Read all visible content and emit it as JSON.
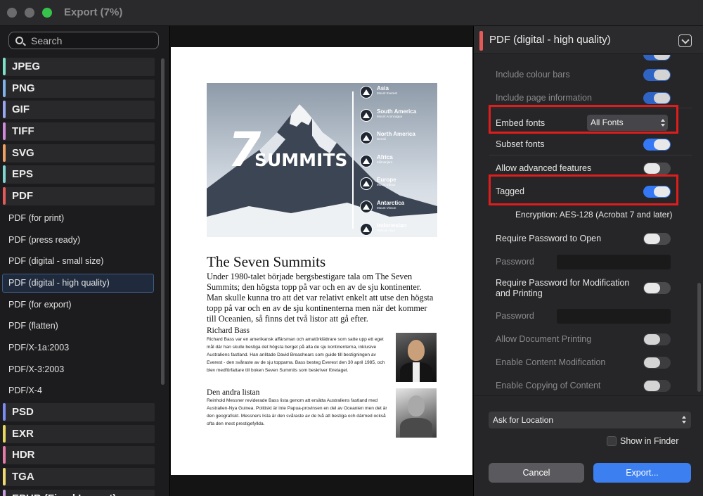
{
  "window": {
    "title": "Export (7%)"
  },
  "sidebar": {
    "search_placeholder": "Search",
    "items": [
      {
        "label": "JPEG",
        "kind": "header",
        "color": "#7fe0c8"
      },
      {
        "label": "PNG",
        "kind": "header",
        "color": "#7fb2ea"
      },
      {
        "label": "GIF",
        "kind": "header",
        "color": "#9aa7f0"
      },
      {
        "label": "TIFF",
        "kind": "header",
        "color": "#d08ad9"
      },
      {
        "label": "SVG",
        "kind": "header",
        "color": "#f0a060"
      },
      {
        "label": "EPS",
        "kind": "header",
        "color": "#7fd6d0"
      },
      {
        "label": "PDF",
        "kind": "header",
        "color": "#e35a58"
      },
      {
        "label": "PDF (for print)",
        "kind": "sub"
      },
      {
        "label": "PDF (press ready)",
        "kind": "sub"
      },
      {
        "label": "PDF (digital - small size)",
        "kind": "sub"
      },
      {
        "label": "PDF (digital - high quality)",
        "kind": "sub",
        "selected": true
      },
      {
        "label": "PDF (for export)",
        "kind": "sub"
      },
      {
        "label": "PDF (flatten)",
        "kind": "sub"
      },
      {
        "label": "PDF/X-1a:2003",
        "kind": "sub"
      },
      {
        "label": "PDF/X-3:2003",
        "kind": "sub"
      },
      {
        "label": "PDF/X-4",
        "kind": "sub"
      },
      {
        "label": "PSD",
        "kind": "header",
        "color": "#7c8cf0"
      },
      {
        "label": "EXR",
        "kind": "header",
        "color": "#e8d860"
      },
      {
        "label": "HDR",
        "kind": "header",
        "color": "#e87aa8"
      },
      {
        "label": "TGA",
        "kind": "header",
        "color": "#f2d870"
      },
      {
        "label": "EPUB (Fixed Layout)",
        "kind": "header",
        "color": "#c8a0e0"
      }
    ]
  },
  "preview": {
    "hero": {
      "seven": "7",
      "summits": "SUMMITS",
      "peaks": [
        {
          "name": "Asia",
          "sub": "Mount Everest"
        },
        {
          "name": "South America",
          "sub": "Mount Aconcagua"
        },
        {
          "name": "North America",
          "sub": "Denali"
        },
        {
          "name": "Africa",
          "sub": "Kilimanjaro"
        },
        {
          "name": "Europe",
          "sub": "Mount Elbrus"
        },
        {
          "name": "Antarctica",
          "sub": "Mount Vinson"
        },
        {
          "name": "Indonesian",
          "sub": "Puncak Jaya"
        }
      ]
    },
    "title": "The Seven Summits",
    "intro": "Under 1980-talet började bergsbestigare tala om The Seven Summits; den högsta topp på var och en av de sju kontinenter. Man skulle kunna tro att det var relativt enkelt att utse den högsta topp på var och en av de sju kontinenterna men när det kommer till Oceanien, så finns det två listor att gå efter.",
    "sections": [
      {
        "title": "Richard Bass",
        "body": "Richard Bass var en amerikansk affärsman och amatörklättrare som satte upp ett eget mål där han skulle bestiga det högsta berget på alla de sju kontinenterna, inklusive Australiens fastland. Han anlitade David Breashears som guide till bestigningen av Everest - den svåraste av de sju topparna. Bass besteg Everest den 30 april 1985, och blev medförfattare till boken Seven Summits som beskriver företaget."
      },
      {
        "title": "Den andra listan",
        "body": "Reinhold Messner reviderade Bass lista genom att ersätta Australiens fastland med Australien-Nya Guinea. Politiskt är inte Papua-provinsen en del av Oceanien men det är den geografiskt. Messners lista är den svåraste av de två att bestiga och därmed också ofta den mest prestigefyllda."
      }
    ]
  },
  "panel": {
    "preset_title": "PDF (digital - high quality)",
    "rows": {
      "colour_bars": {
        "label": "Include colour bars",
        "on": true
      },
      "page_info": {
        "label": "Include page information",
        "on": true
      },
      "embed_fonts": {
        "label": "Embed fonts",
        "value": "All Fonts"
      },
      "subset_fonts": {
        "label": "Subset fonts",
        "on": true
      },
      "advanced": {
        "label": "Allow advanced features",
        "on": false
      },
      "tagged": {
        "label": "Tagged",
        "on": true
      },
      "encryption": "Encryption: AES-128 (Acrobat 7 and later)",
      "req_open": {
        "label": "Require Password to Open",
        "on": false
      },
      "password_label": "Password",
      "req_mod": {
        "label": "Require Password for Modification and Printing",
        "on": false
      },
      "allow_print": {
        "label": "Allow Document Printing",
        "on": false
      },
      "allow_mod": {
        "label": "Enable Content Modification",
        "on": false
      },
      "allow_copy": {
        "label": "Enable Copying of Content",
        "on": false
      }
    },
    "location": "Ask for Location",
    "show_in_finder": "Show in Finder",
    "cancel": "Cancel",
    "export": "Export..."
  }
}
